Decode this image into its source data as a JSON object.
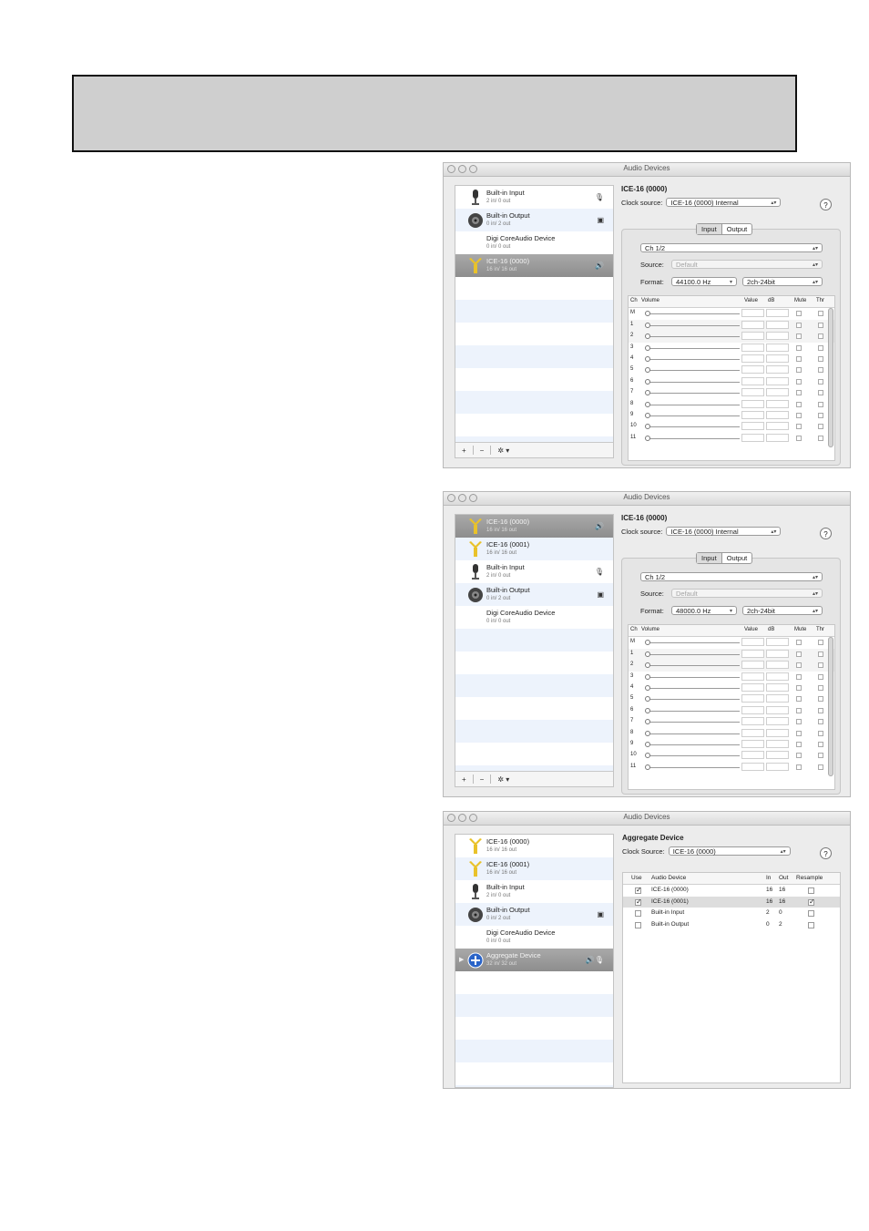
{
  "panes": [
    {
      "window_title": "Audio Devices",
      "devices": [
        {
          "name": "Built-in Input",
          "io": "2 in/ 0 out",
          "icon": "microphone-icon",
          "badge": "mic",
          "selected": false
        },
        {
          "name": "Built-in Output",
          "io": "0 in/ 2 out",
          "icon": "speaker-icon",
          "badge": "output",
          "selected": false
        },
        {
          "name": "Digi CoreAudio Device",
          "io": "0 in/ 0 out",
          "icon": "",
          "badge": "",
          "selected": false
        },
        {
          "name": "ICE-16 (0000)",
          "io": "16 in/ 16 out",
          "icon": "usb-icon",
          "badge": "speaker",
          "selected": true
        }
      ],
      "device_title": "ICE-16 (0000)",
      "clock_label": "Clock source:",
      "clock_value": "ICE-16 (0000) Internal",
      "tabs": [
        "Input",
        "Output"
      ],
      "channel_pair": "Ch 1/2",
      "source_label": "Source:",
      "source_value": "Default",
      "format_label": "Format:",
      "format_value": "44100.0 Hz",
      "bit_value": "2ch-24bit",
      "table_headers": [
        "Ch",
        "Volume",
        "Value",
        "dB",
        "Mute",
        "Thr"
      ],
      "channels": [
        "M",
        "1",
        "2",
        "3",
        "4",
        "5",
        "6",
        "7",
        "8",
        "9",
        "10",
        "11"
      ]
    },
    {
      "window_title": "Audio Devices",
      "devices": [
        {
          "name": "ICE-16 (0000)",
          "io": "16 in/ 16 out",
          "icon": "usb-icon",
          "badge": "speaker",
          "selected": true
        },
        {
          "name": "ICE-16 (0001)",
          "io": "16 in/ 16 out",
          "icon": "usb-icon",
          "badge": "",
          "selected": false
        },
        {
          "name": "Built-in Input",
          "io": "2 in/ 0 out",
          "icon": "microphone-icon",
          "badge": "mic",
          "selected": false
        },
        {
          "name": "Built-in Output",
          "io": "0 in/ 2 out",
          "icon": "speaker-icon",
          "badge": "output",
          "selected": false
        },
        {
          "name": "Digi CoreAudio Device",
          "io": "0 in/ 0 out",
          "icon": "",
          "badge": "",
          "selected": false
        }
      ],
      "device_title": "ICE-16 (0000)",
      "clock_label": "Clock source:",
      "clock_value": "ICE-16 (0000) Internal",
      "tabs": [
        "Input",
        "Output"
      ],
      "channel_pair": "Ch 1/2",
      "source_label": "Source:",
      "source_value": "Default",
      "format_label": "Format:",
      "format_value": "48000.0 Hz",
      "bit_value": "2ch-24bit",
      "table_headers": [
        "Ch",
        "Volume",
        "Value",
        "dB",
        "Mute",
        "Thr"
      ],
      "channels": [
        "M",
        "1",
        "2",
        "3",
        "4",
        "5",
        "6",
        "7",
        "8",
        "9",
        "10",
        "11"
      ]
    },
    {
      "window_title": "Audio Devices",
      "devices": [
        {
          "name": "ICE-16 (0000)",
          "io": "16 in/ 16 out",
          "icon": "usb-icon",
          "badge": "",
          "selected": false
        },
        {
          "name": "ICE-16 (0001)",
          "io": "16 in/ 16 out",
          "icon": "usb-icon",
          "badge": "",
          "selected": false
        },
        {
          "name": "Built-in Input",
          "io": "2 in/ 0 out",
          "icon": "microphone-icon",
          "badge": "",
          "selected": false
        },
        {
          "name": "Built-in Output",
          "io": "0 in/ 2 out",
          "icon": "speaker-icon",
          "badge": "output",
          "selected": false
        },
        {
          "name": "Digi CoreAudio Device",
          "io": "0 in/ 0 out",
          "icon": "",
          "badge": "",
          "selected": false
        },
        {
          "name": "Aggregate Device",
          "io": "32 in/ 32 out",
          "icon": "aggregate-icon",
          "badge": "speaker-mic",
          "selected": true
        }
      ],
      "device_title": "Aggregate Device",
      "clock_label": "Clock Source:",
      "clock_value": "ICE-16 (0000)",
      "agg_headers": [
        "Use",
        "Audio Device",
        "In",
        "Out",
        "Resample"
      ],
      "agg_rows": [
        {
          "use": true,
          "device": "ICE-16 (0000)",
          "in": "16",
          "out": "16",
          "resample": false,
          "selected": false
        },
        {
          "use": true,
          "device": "ICE-16 (0001)",
          "in": "16",
          "out": "16",
          "resample": true,
          "selected": true
        },
        {
          "use": false,
          "device": "Built-in Input",
          "in": "2",
          "out": "0",
          "resample": false,
          "selected": false
        },
        {
          "use": false,
          "device": "Built-in Output",
          "in": "0",
          "out": "2",
          "resample": false,
          "selected": false
        }
      ]
    }
  ],
  "list_buttons": {
    "add": "+",
    "remove": "−",
    "gear": "✲ ▾"
  },
  "help_glyph": "?",
  "colors": {
    "selected_row": "#999999",
    "stripe": "#edf3fc",
    "usb_icon": "#e9c22a",
    "aggregate_icon": "#2a64c8"
  }
}
